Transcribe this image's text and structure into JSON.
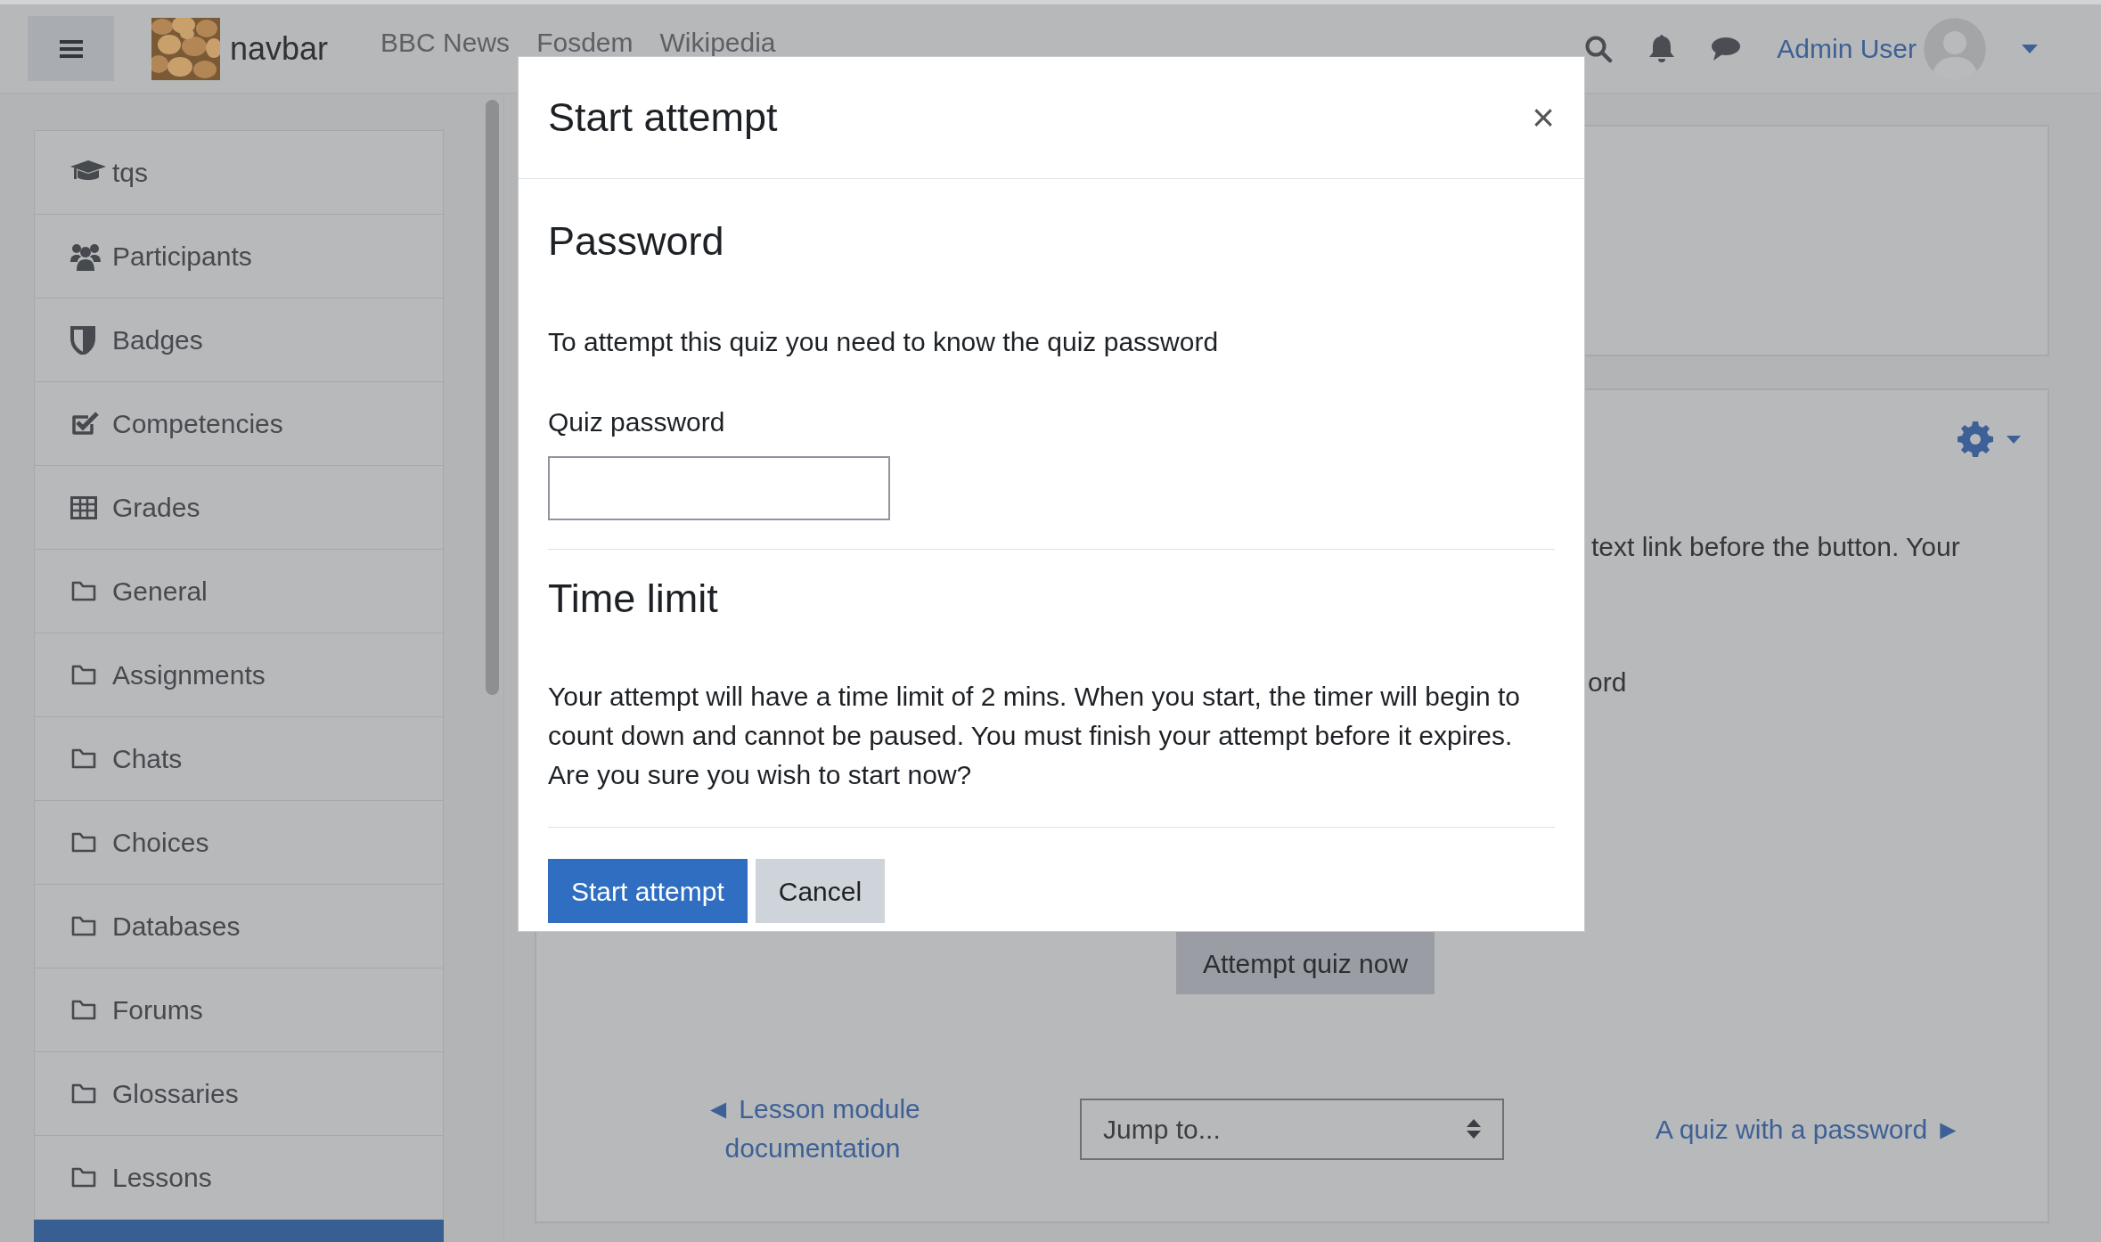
{
  "navbar": {
    "brand": "navbar",
    "links": [
      "BBC News",
      "Fosdem",
      "Wikipedia"
    ],
    "user": "Admin User"
  },
  "sidebar": {
    "items": [
      {
        "label": "tqs",
        "kind": "course",
        "selected": false
      },
      {
        "label": "Participants",
        "kind": "participants",
        "selected": false
      },
      {
        "label": "Badges",
        "kind": "badges",
        "selected": false
      },
      {
        "label": "Competencies",
        "kind": "competencies",
        "selected": false
      },
      {
        "label": "Grades",
        "kind": "grades",
        "selected": false
      },
      {
        "label": "General",
        "kind": "folder",
        "selected": false
      },
      {
        "label": "Assignments",
        "kind": "folder",
        "selected": false
      },
      {
        "label": "Chats",
        "kind": "folder",
        "selected": false
      },
      {
        "label": "Choices",
        "kind": "folder",
        "selected": false
      },
      {
        "label": "Databases",
        "kind": "folder",
        "selected": false
      },
      {
        "label": "Forums",
        "kind": "folder",
        "selected": false
      },
      {
        "label": "Glossaries",
        "kind": "folder",
        "selected": false
      },
      {
        "label": "Lessons",
        "kind": "folder",
        "selected": false
      },
      {
        "selected": true
      }
    ]
  },
  "main": {
    "visible_texts": [
      "text link before the button. Your",
      "ord"
    ],
    "attempt_button": "Attempt quiz now",
    "prev_link": "◄ Lesson module documentation",
    "jump_select": {
      "value": "Jump to..."
    },
    "next_link": "A quiz with a password ►"
  },
  "modal": {
    "title": "Start attempt",
    "close": "×",
    "sections": [
      {
        "heading": "Password",
        "text": "To attempt this quiz you need to know the quiz password",
        "field_label": "Quiz password"
      },
      {
        "heading": "Time limit",
        "text": "Your attempt will have a time limit of 2 mins. When you start, the timer will begin to count down and cannot be paused. You must finish your attempt before it expires. Are you sure you wish to start now?"
      }
    ],
    "buttons": [
      {
        "label": "Start attempt",
        "kind": "primary"
      },
      {
        "label": "Cancel",
        "kind": "secondary"
      }
    ]
  }
}
